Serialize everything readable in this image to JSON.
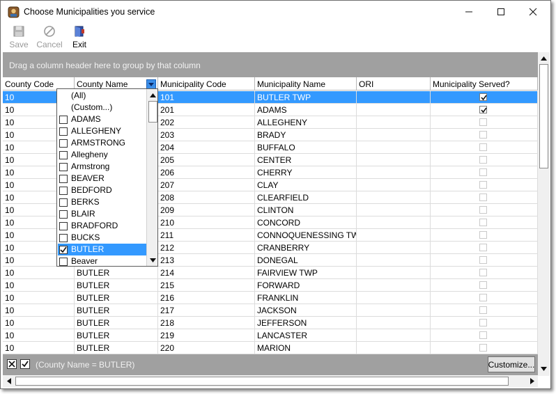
{
  "window": {
    "title": "Choose Municipalities you service"
  },
  "toolbar": {
    "save": "Save",
    "cancel": "Cancel",
    "exit": "Exit"
  },
  "grid": {
    "group_hint": "Drag a column header here to group by that column",
    "columns": [
      "County Code",
      "County Name",
      "Municipality Code",
      "Municipality Name",
      "ORI",
      "Municipality Served?"
    ],
    "rows": [
      {
        "county_code": "10",
        "county_name": "BUTLER",
        "muni_code": "101",
        "muni_name": "BUTLER TWP",
        "ori": "",
        "served": true,
        "selected": true
      },
      {
        "county_code": "10",
        "county_name": "BUTLER",
        "muni_code": "201",
        "muni_name": "ADAMS",
        "ori": "",
        "served": true
      },
      {
        "county_code": "10",
        "county_name": "BUTLER",
        "muni_code": "202",
        "muni_name": "ALLEGHENY",
        "ori": "",
        "served": false
      },
      {
        "county_code": "10",
        "county_name": "BUTLER",
        "muni_code": "203",
        "muni_name": "BRADY",
        "ori": "",
        "served": false
      },
      {
        "county_code": "10",
        "county_name": "BUTLER",
        "muni_code": "204",
        "muni_name": "BUFFALO",
        "ori": "",
        "served": false
      },
      {
        "county_code": "10",
        "county_name": "BUTLER",
        "muni_code": "205",
        "muni_name": "CENTER",
        "ori": "",
        "served": false
      },
      {
        "county_code": "10",
        "county_name": "BUTLER",
        "muni_code": "206",
        "muni_name": "CHERRY",
        "ori": "",
        "served": false
      },
      {
        "county_code": "10",
        "county_name": "BUTLER",
        "muni_code": "207",
        "muni_name": "CLAY",
        "ori": "",
        "served": false
      },
      {
        "county_code": "10",
        "county_name": "BUTLER",
        "muni_code": "208",
        "muni_name": "CLEARFIELD",
        "ori": "",
        "served": false
      },
      {
        "county_code": "10",
        "county_name": "BUTLER",
        "muni_code": "209",
        "muni_name": "CLINTON",
        "ori": "",
        "served": false
      },
      {
        "county_code": "10",
        "county_name": "BUTLER",
        "muni_code": "210",
        "muni_name": "CONCORD",
        "ori": "",
        "served": false
      },
      {
        "county_code": "10",
        "county_name": "BUTLER",
        "muni_code": "211",
        "muni_name": "CONNOQUENESSING TWP",
        "ori": "",
        "served": false
      },
      {
        "county_code": "10",
        "county_name": "BUTLER",
        "muni_code": "212",
        "muni_name": "CRANBERRY",
        "ori": "",
        "served": false
      },
      {
        "county_code": "10",
        "county_name": "BUTLER",
        "muni_code": "213",
        "muni_name": "DONEGAL",
        "ori": "",
        "served": false
      },
      {
        "county_code": "10",
        "county_name": "BUTLER",
        "muni_code": "214",
        "muni_name": "FAIRVIEW TWP",
        "ori": "",
        "served": false
      },
      {
        "county_code": "10",
        "county_name": "BUTLER",
        "muni_code": "215",
        "muni_name": "FORWARD",
        "ori": "",
        "served": false
      },
      {
        "county_code": "10",
        "county_name": "BUTLER",
        "muni_code": "216",
        "muni_name": "FRANKLIN",
        "ori": "",
        "served": false
      },
      {
        "county_code": "10",
        "county_name": "BUTLER",
        "muni_code": "217",
        "muni_name": "JACKSON",
        "ori": "",
        "served": false
      },
      {
        "county_code": "10",
        "county_name": "BUTLER",
        "muni_code": "218",
        "muni_name": "JEFFERSON",
        "ori": "",
        "served": false
      },
      {
        "county_code": "10",
        "county_name": "BUTLER",
        "muni_code": "219",
        "muni_name": "LANCASTER",
        "ori": "",
        "served": false
      },
      {
        "county_code": "10",
        "county_name": "BUTLER",
        "muni_code": "220",
        "muni_name": "MARION",
        "ori": "",
        "served": false
      }
    ]
  },
  "filter_dropdown": {
    "items": [
      {
        "label": "(All)",
        "checkbox": false
      },
      {
        "label": "(Custom...)",
        "checkbox": false
      },
      {
        "label": "ADAMS",
        "checkbox": true,
        "checked": false
      },
      {
        "label": "ALLEGHENY",
        "checkbox": true,
        "checked": false
      },
      {
        "label": "ARMSTRONG",
        "checkbox": true,
        "checked": false
      },
      {
        "label": "Allegheny",
        "checkbox": true,
        "checked": false
      },
      {
        "label": "Armstrong",
        "checkbox": true,
        "checked": false
      },
      {
        "label": "BEAVER",
        "checkbox": true,
        "checked": false
      },
      {
        "label": "BEDFORD",
        "checkbox": true,
        "checked": false
      },
      {
        "label": "BERKS",
        "checkbox": true,
        "checked": false
      },
      {
        "label": "BLAIR",
        "checkbox": true,
        "checked": false
      },
      {
        "label": "BRADFORD",
        "checkbox": true,
        "checked": false
      },
      {
        "label": "BUCKS",
        "checkbox": true,
        "checked": false
      },
      {
        "label": "BUTLER",
        "checkbox": true,
        "checked": true,
        "selected": true
      },
      {
        "label": "Beaver",
        "checkbox": true,
        "checked": false
      }
    ]
  },
  "filter_bar": {
    "text": "(County Name = BUTLER)",
    "customize": "Customize..."
  },
  "colors": {
    "selection": "#3399ff",
    "panel_gray": "#a0a0a0"
  }
}
